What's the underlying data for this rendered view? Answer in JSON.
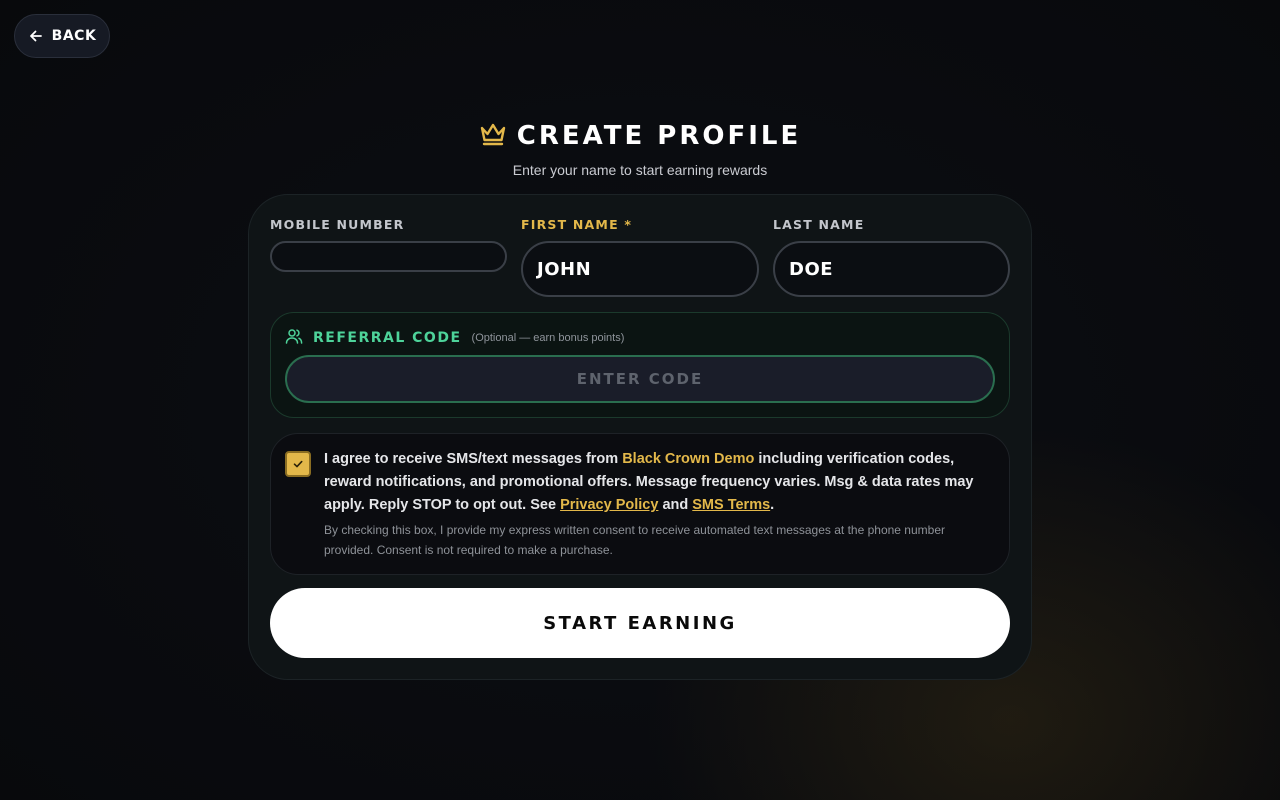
{
  "nav": {
    "back_label": "BACK"
  },
  "header": {
    "title": "CREATE PROFILE",
    "subtitle": "Enter your name to start earning rewards"
  },
  "form": {
    "mobile": {
      "label": "MOBILE NUMBER",
      "value": ""
    },
    "first_name": {
      "label": "FIRST NAME *",
      "value": "JOHN"
    },
    "last_name": {
      "label": "LAST NAME",
      "value": "DOE"
    },
    "referral": {
      "title": "REFERRAL CODE",
      "optional_note": "(Optional — earn bonus points)",
      "placeholder": "ENTER CODE"
    },
    "consent": {
      "checked": true,
      "text_before": "I agree to receive SMS/text messages from ",
      "brand": "Black Crown Demo",
      "text_middle": " including verification codes, reward notifications, and promotional offers. Message frequency varies. Msg & data rates may apply. Reply STOP to opt out. See ",
      "privacy_link": "Privacy Policy",
      "and_text": " and ",
      "terms_link": "SMS Terms",
      "period": ".",
      "fine_print": "By checking this box, I provide my express written consent to receive automated text messages at the phone number provided. Consent is not required to make a purchase."
    },
    "submit_label": "START EARNING"
  },
  "colors": {
    "accent_gold": "#e3b84a",
    "accent_green": "#4ed39a",
    "background": "#08090c",
    "card": "#0f1416"
  },
  "icons": {
    "back": "arrow-left-icon",
    "title": "crown-icon",
    "referral": "users-icon",
    "checkbox": "check-icon"
  }
}
